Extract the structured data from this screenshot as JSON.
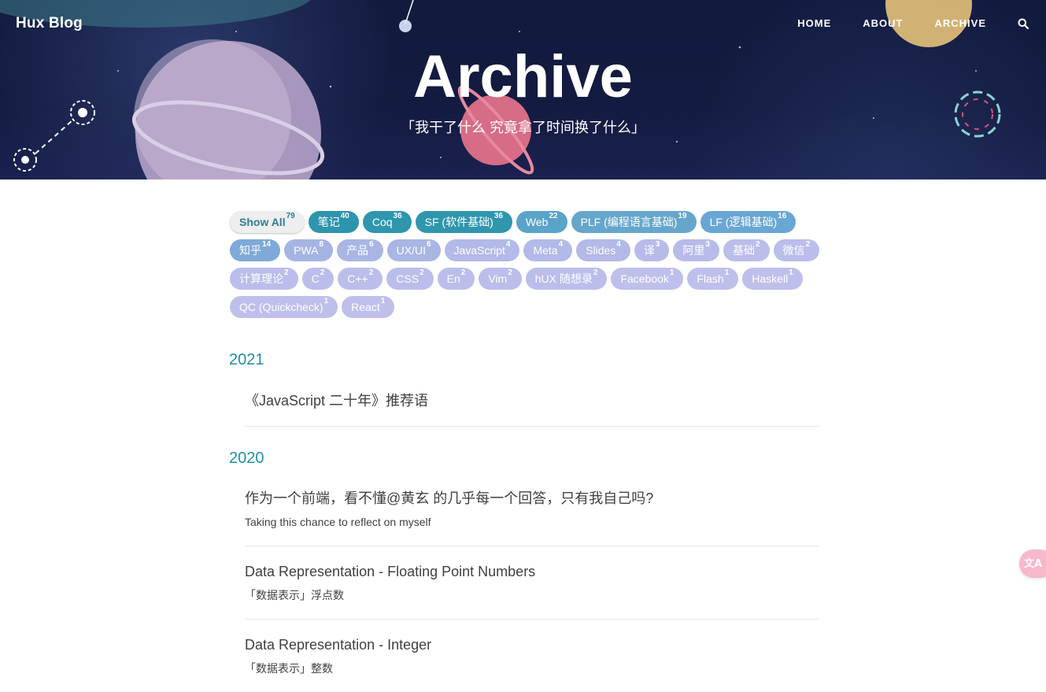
{
  "header": {
    "brand": "Hux Blog",
    "nav": [
      "HOME",
      "ABOUT",
      "ARCHIVE"
    ],
    "title": "Archive",
    "subtitle": "「我干了什么 究竟拿了时间换了什么」"
  },
  "tags": [
    {
      "label": "Show All",
      "count": "79",
      "color": "#eeeeee"
    },
    {
      "label": "笔记",
      "count": "40",
      "color": "#2d95ad"
    },
    {
      "label": "Coq",
      "count": "36",
      "color": "#2f96ae"
    },
    {
      "label": "SF (软件基础)",
      "count": "36",
      "color": "#2f96ae"
    },
    {
      "label": "Web",
      "count": "22",
      "color": "#5aa3c9"
    },
    {
      "label": "PLF (编程语言基础)",
      "count": "19",
      "color": "#67a6cc"
    },
    {
      "label": "LF (逻辑基础)",
      "count": "16",
      "color": "#6aa6d4"
    },
    {
      "label": "知乎",
      "count": "14",
      "color": "#7ea9d9"
    },
    {
      "label": "PWA",
      "count": "8",
      "color": "#a5b4e3"
    },
    {
      "label": "产品",
      "count": "6",
      "color": "#a9b6e4"
    },
    {
      "label": "UX/UI",
      "count": "6",
      "color": "#a9b6e4"
    },
    {
      "label": "JavaScript",
      "count": "4",
      "color": "#b3b9e8"
    },
    {
      "label": "Meta",
      "count": "4",
      "color": "#b3b9e8"
    },
    {
      "label": "Slides",
      "count": "4",
      "color": "#b3b9e8"
    },
    {
      "label": "译",
      "count": "3",
      "color": "#b8bbea"
    },
    {
      "label": "阿里",
      "count": "3",
      "color": "#b8bbea"
    },
    {
      "label": "基础",
      "count": "2",
      "color": "#bbbdeb"
    },
    {
      "label": "微信",
      "count": "2",
      "color": "#bbbdeb"
    },
    {
      "label": "计算理论",
      "count": "2",
      "color": "#bbbdeb"
    },
    {
      "label": "C",
      "count": "2",
      "color": "#bbbdeb"
    },
    {
      "label": "C++",
      "count": "2",
      "color": "#bbbdeb"
    },
    {
      "label": "CSS",
      "count": "2",
      "color": "#bbbdeb"
    },
    {
      "label": "En",
      "count": "2",
      "color": "#bbbdeb"
    },
    {
      "label": "Vim",
      "count": "2",
      "color": "#bbbdeb"
    },
    {
      "label": "hUX 随想录",
      "count": "2",
      "color": "#bbbdeb"
    },
    {
      "label": "Facebook",
      "count": "1",
      "color": "#bfbfec"
    },
    {
      "label": "Flash",
      "count": "1",
      "color": "#bfbfec"
    },
    {
      "label": "Haskell",
      "count": "1",
      "color": "#bfbfec"
    },
    {
      "label": "QC (Quickcheck)",
      "count": "1",
      "color": "#bfbfec"
    },
    {
      "label": "React",
      "count": "1",
      "color": "#bfbfec"
    }
  ],
  "archive": [
    {
      "year": "2021",
      "posts": [
        {
          "title": "《JavaScript 二十年》推荐语",
          "subtitle": ""
        }
      ]
    },
    {
      "year": "2020",
      "posts": [
        {
          "title": "作为一个前端，看不懂@黄玄 的几乎每一个回答，只有我自己吗?",
          "subtitle": "Taking this chance to reflect on myself"
        },
        {
          "title": "Data Representation - Floating Point Numbers",
          "subtitle": "「数据表示」浮点数"
        },
        {
          "title": "Data Representation - Integer",
          "subtitle": "「数据表示」整数"
        }
      ]
    }
  ],
  "theme": {
    "year_color": "#1f8fa8",
    "fab_color": "#f7b8cc"
  },
  "icons": {
    "search": "search-icon",
    "translate": "translate-icon"
  }
}
